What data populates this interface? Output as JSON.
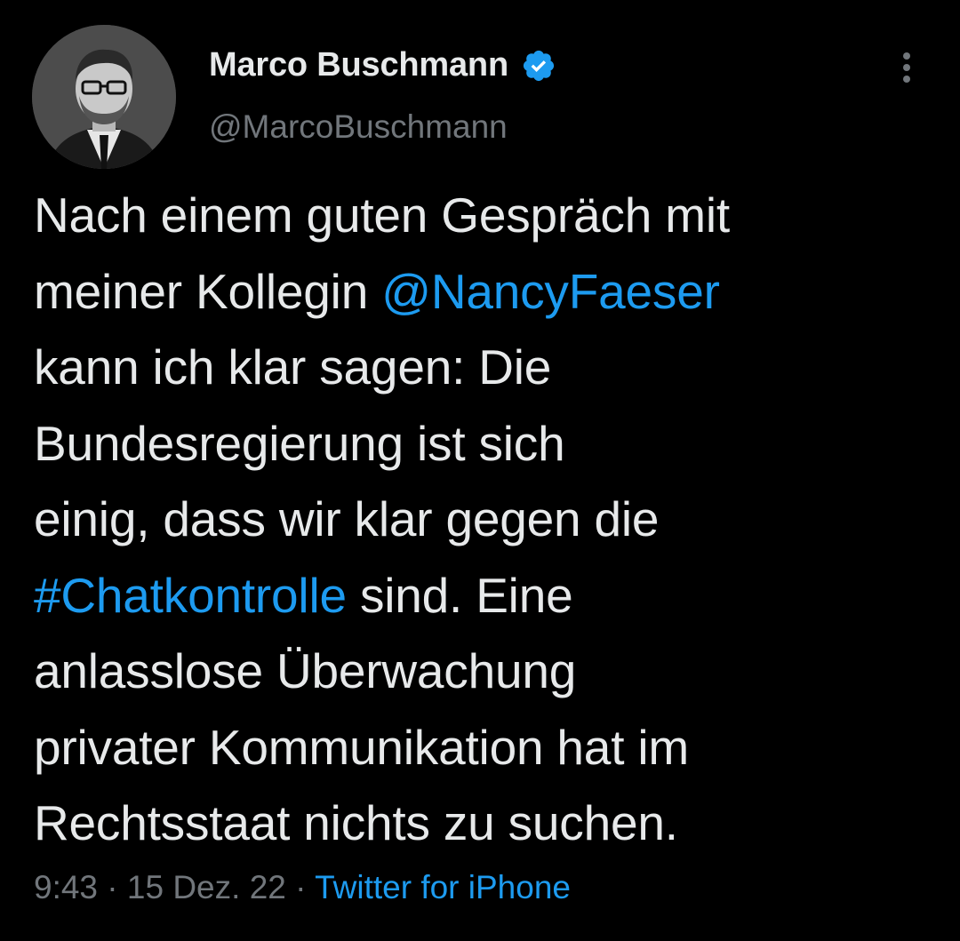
{
  "author": {
    "display_name": "Marco Buschmann",
    "handle": "@MarcoBuschmann",
    "verified_icon": "verified-badge-icon",
    "avatar_icon": "profile-photo"
  },
  "more_icon": "more-vertical-icon",
  "tweet": {
    "lines": [
      {
        "before": "Nach einem guten Gespräch mit",
        "link": "",
        "after": ""
      },
      {
        "before": "meiner Kollegin ",
        "link": "@NancyFaeser",
        "after": ""
      },
      {
        "before": "kann ich klar sagen: Die",
        "link": "",
        "after": ""
      },
      {
        "before": "Bundesregierung ist sich",
        "link": "",
        "after": ""
      },
      {
        "before": "einig, dass wir klar gegen die",
        "link": "",
        "after": ""
      },
      {
        "before": "",
        "link": "#Chatkontrolle",
        "after": " sind. Eine"
      },
      {
        "before": "anlasslose Überwachung",
        "link": "",
        "after": ""
      },
      {
        "before": "privater Kommunikation hat im",
        "link": "",
        "after": ""
      },
      {
        "before": "Rechtsstaat nichts zu suchen.",
        "link": "",
        "after": ""
      }
    ]
  },
  "meta": {
    "time": "9:43",
    "separator": " · ",
    "date": "15 Dez. 22",
    "source": "Twitter for iPhone"
  },
  "colors": {
    "background": "#000000",
    "text": "#e7e9ea",
    "secondary": "#71767b",
    "link": "#1d9bf0"
  }
}
